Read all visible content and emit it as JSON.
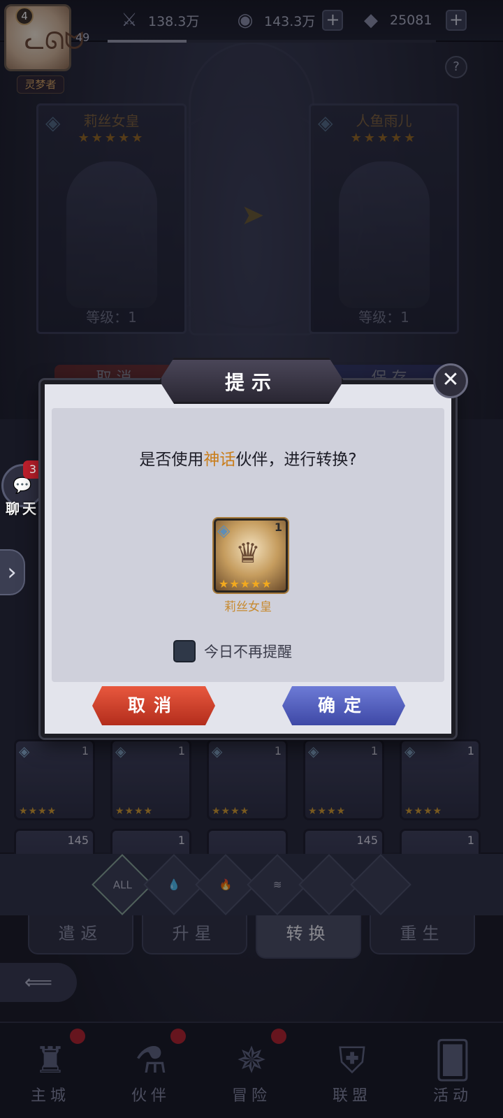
{
  "topbar": {
    "level": "4",
    "exp": "49",
    "title": "灵梦者",
    "power": "138.3万",
    "gold": "143.3万",
    "diamonds": "25081",
    "help_label": "?"
  },
  "heroes": {
    "left": {
      "name": "莉丝女皇",
      "stars": "★★★★★",
      "level": "等级：1"
    },
    "right": {
      "name": "人鱼雨儿",
      "stars": "★★★★★",
      "level": "等级：1"
    }
  },
  "bg_buttons": {
    "left": "取 消",
    "right": "保 存"
  },
  "grid": {
    "row1": [
      {
        "count": "1",
        "stars": "★★★★"
      },
      {
        "count": "1",
        "stars": "★★★★"
      },
      {
        "count": "1",
        "stars": "★★★★"
      },
      {
        "count": "1",
        "stars": "★★★★"
      },
      {
        "count": "1",
        "stars": "★★★★"
      }
    ],
    "row2": [
      {
        "count": "145",
        "stars": ""
      },
      {
        "count": "1",
        "stars": ""
      },
      {
        "count": "",
        "stars": ""
      },
      {
        "count": "145",
        "stars": ""
      },
      {
        "count": "1",
        "stars": ""
      }
    ]
  },
  "filters": {
    "all": "ALL"
  },
  "tabs": [
    "遣返",
    "升星",
    "转换",
    "重生"
  ],
  "active_tab": "转换",
  "bottom_nav": [
    "主城",
    "伙伴",
    "冒险",
    "联盟",
    "活动"
  ],
  "chat": {
    "label": "聊天",
    "badge": "3"
  },
  "dialog": {
    "title": "提示",
    "question_pre": "是否使用",
    "question_highlight": "神话",
    "question_post": "伙伴，进行转换?",
    "hero_name": "莉丝女皇",
    "hero_count": "1",
    "hero_stars": "★★★★★",
    "remind_label": "今日不再提醒",
    "cancel_label": "取消",
    "confirm_label": "确定",
    "close_label": "✕"
  },
  "colors": {
    "highlight": "#c97d1a",
    "cancel": "#c9391f",
    "confirm": "#5360bf",
    "badge": "#c0202c"
  }
}
